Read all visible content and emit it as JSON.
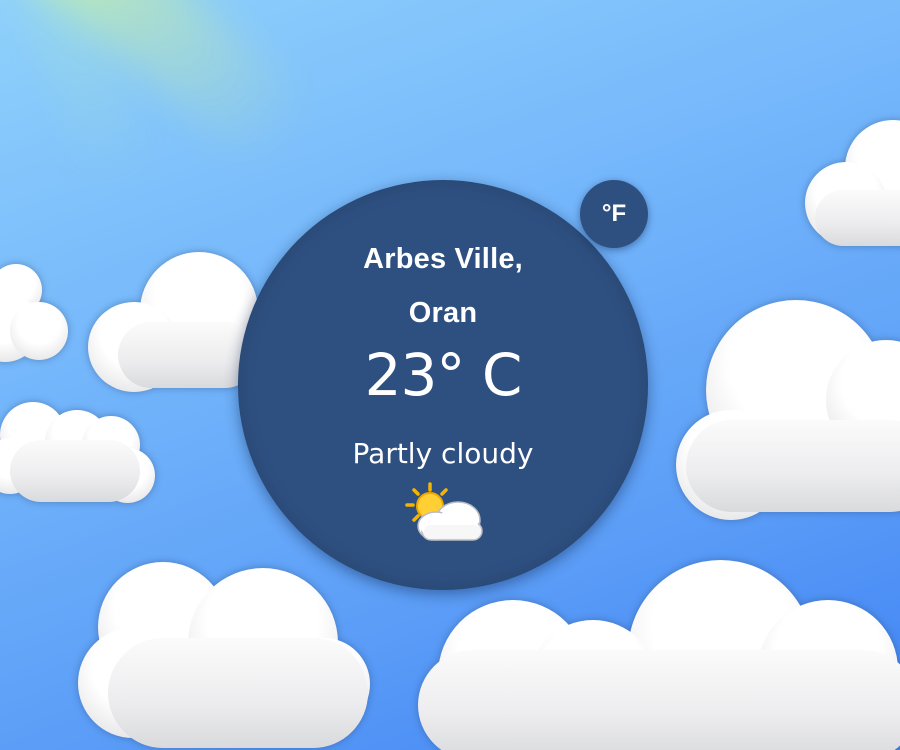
{
  "location": {
    "line1": "Arbes Ville,",
    "line2": "Oran"
  },
  "temperature": {
    "display": "23° C",
    "value": 23,
    "unit": "C"
  },
  "condition": {
    "text": "Partly cloudy",
    "icon": "partly-cloudy-icon"
  },
  "unit_toggle": {
    "label": "°F"
  },
  "colors": {
    "card": "#2e5081",
    "sky_top": "#8fd1fb",
    "sky_bottom": "#3f82f4",
    "text": "#ffffff"
  }
}
